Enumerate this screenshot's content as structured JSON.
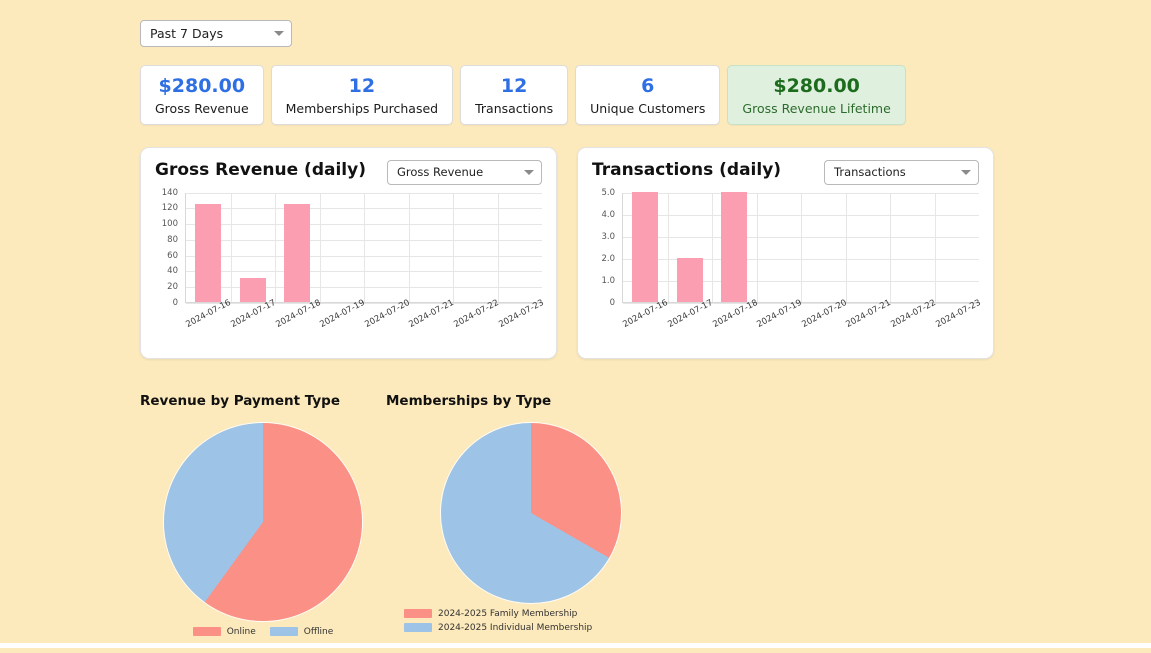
{
  "theme": {
    "page_background": "#fceabc",
    "accent_blue": "#2f6fe4",
    "accent_green": "#1d6b1d",
    "bar_pink": "#fb9eb1",
    "pie_salmon": "#fa9086",
    "pie_blue": "#9dc3e6"
  },
  "range_filter": {
    "value": "Past 7 Days",
    "icon": "chevron-down-icon"
  },
  "stats": [
    {
      "value": "$280.00",
      "label": "Gross Revenue",
      "highlight": false
    },
    {
      "value": "12",
      "label": "Memberships Purchased",
      "highlight": false
    },
    {
      "value": "12",
      "label": "Transactions",
      "highlight": false
    },
    {
      "value": "6",
      "label": "Unique Customers",
      "highlight": false
    },
    {
      "value": "$280.00",
      "label": "Gross Revenue Lifetime",
      "highlight": true
    }
  ],
  "panels": [
    {
      "title": "Gross Revenue (daily)",
      "metric_select": "Gross Revenue"
    },
    {
      "title": "Transactions (daily)",
      "metric_select": "Transactions"
    }
  ],
  "pie_titles": {
    "revenue": "Revenue by Payment Type",
    "memberships": "Memberships by Type"
  },
  "chart_data": [
    {
      "type": "bar",
      "title": "Gross Revenue (daily)",
      "categories": [
        "2024-07-16",
        "2024-07-17",
        "2024-07-18",
        "2024-07-19",
        "2024-07-20",
        "2024-07-21",
        "2024-07-22",
        "2024-07-23"
      ],
      "values": [
        125,
        30,
        125,
        0,
        0,
        0,
        0,
        0
      ],
      "yticks": [
        0,
        20,
        40,
        60,
        80,
        100,
        120,
        140
      ],
      "ylim": [
        0,
        140
      ],
      "xlabel": "",
      "ylabel": "",
      "grid": true,
      "legend": "none"
    },
    {
      "type": "bar",
      "title": "Transactions (daily)",
      "categories": [
        "2024-07-16",
        "2024-07-17",
        "2024-07-18",
        "2024-07-19",
        "2024-07-20",
        "2024-07-21",
        "2024-07-22",
        "2024-07-23"
      ],
      "values": [
        5,
        2,
        5,
        0,
        0,
        0,
        0,
        0
      ],
      "yticks": [
        "0",
        "1.0",
        "2.0",
        "3.0",
        "4.0",
        "5.0"
      ],
      "ytick_values": [
        0,
        1,
        2,
        3,
        4,
        5
      ],
      "ylim": [
        0,
        5
      ],
      "xlabel": "",
      "ylabel": "",
      "grid": true,
      "legend": "none"
    },
    {
      "type": "pie",
      "title": "Revenue by Payment Type",
      "labels": [
        "Online",
        "Offline"
      ],
      "values": [
        60,
        40
      ],
      "colors": [
        "#fa9086",
        "#9dc3e6"
      ],
      "legend": "bottom"
    },
    {
      "type": "pie",
      "title": "Memberships by Type",
      "labels": [
        "2024-2025 Family Membership",
        "2024-2025 Individual Membership"
      ],
      "values": [
        33.3,
        66.7
      ],
      "colors": [
        "#fa9086",
        "#9dc3e6"
      ],
      "legend": "bottom"
    }
  ]
}
